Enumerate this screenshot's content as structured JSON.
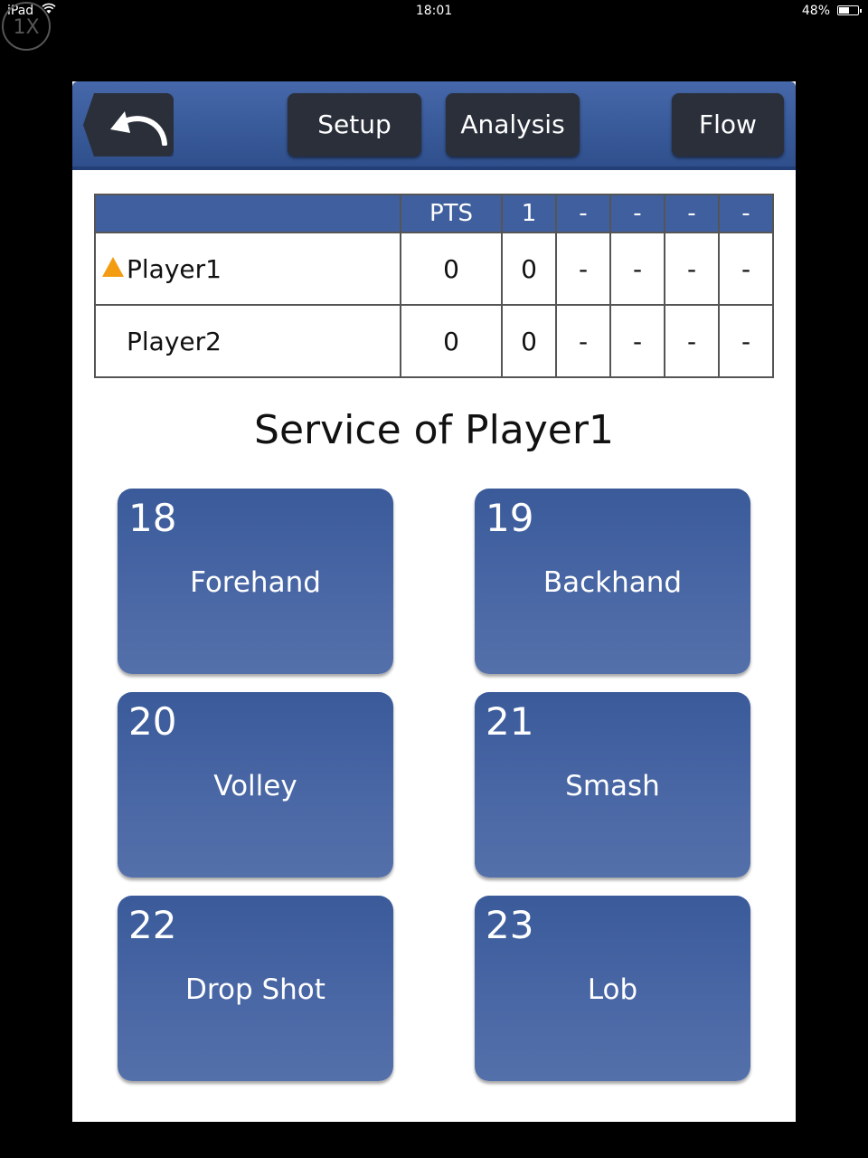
{
  "status_bar": {
    "device": "iPad",
    "time": "18:01",
    "battery": "48%",
    "battery_level": 0.48,
    "zoom_badge": "1X"
  },
  "toolbar": {
    "back_icon": "undo-arrow-icon",
    "setup_label": "Setup",
    "analysis_label": "Analysis",
    "flow_label": "Flow"
  },
  "score_table": {
    "headers": [
      "",
      "PTS",
      "1",
      "-",
      "-",
      "-",
      "-"
    ],
    "rows": [
      {
        "serving": true,
        "name": "Player1",
        "cells": [
          "0",
          "0",
          "-",
          "-",
          "-",
          "-"
        ]
      },
      {
        "serving": false,
        "name": "Player2",
        "cells": [
          "0",
          "0",
          "-",
          "-",
          "-",
          "-"
        ]
      }
    ],
    "serve_indicator_color": "#f39c12"
  },
  "service_title": "Service of Player1",
  "shots": [
    {
      "num": "18",
      "label": "Forehand"
    },
    {
      "num": "19",
      "label": "Backhand"
    },
    {
      "num": "20",
      "label": "Volley"
    },
    {
      "num": "21",
      "label": "Smash"
    },
    {
      "num": "22",
      "label": "Drop Shot"
    },
    {
      "num": "23",
      "label": "Lob"
    }
  ],
  "colors": {
    "toolbar": "#3b5c9c",
    "button_dark": "#2a2f3a",
    "shot_button": "#4563a3"
  }
}
